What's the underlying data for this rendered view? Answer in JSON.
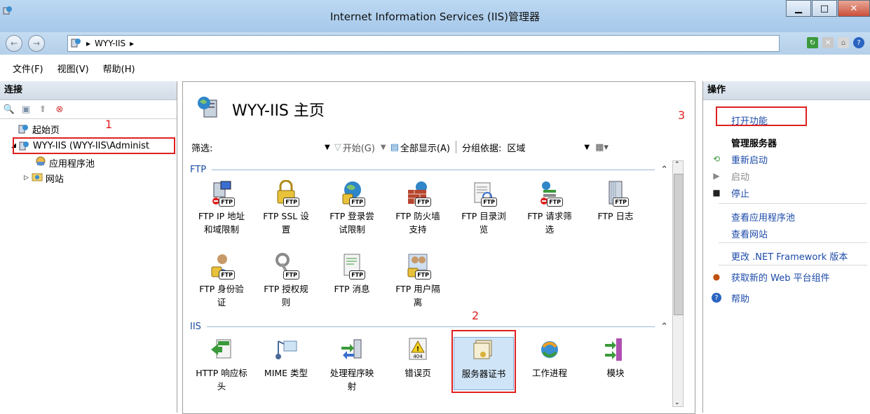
{
  "window": {
    "title": "Internet Information Services (IIS)管理器"
  },
  "address": {
    "path": [
      "WYY-IIS"
    ]
  },
  "menu": [
    "文件(F)",
    "视图(V)",
    "帮助(H)"
  ],
  "left": {
    "header": "连接",
    "tree": [
      {
        "label": "起始页",
        "level": 1
      },
      {
        "label": "WYY-IIS (WYY-IIS\\Administ",
        "level": 1
      },
      {
        "label": "应用程序池",
        "level": 2
      },
      {
        "label": "网站",
        "level": 2
      }
    ],
    "annotation": "1"
  },
  "center": {
    "title": "WYY-IIS 主页",
    "annotation_title": "3",
    "annotation_cert": "2",
    "filter": {
      "label": "筛选:",
      "start": "开始(G)",
      "show_all": "全部显示(A)",
      "group_label": "分组依据:",
      "group_value": "区域"
    },
    "groups": [
      {
        "name": "FTP",
        "features": [
          {
            "l1": "FTP IP 地址",
            "l2": "和域限制"
          },
          {
            "l1": "FTP SSL 设",
            "l2": "置"
          },
          {
            "l1": "FTP 登录尝",
            "l2": "试限制"
          },
          {
            "l1": "FTP 防火墙",
            "l2": "支持"
          },
          {
            "l1": "FTP 目录浏",
            "l2": "览"
          },
          {
            "l1": "FTP 请求筛",
            "l2": "选"
          },
          {
            "l1": "FTP 日志",
            "l2": ""
          },
          {
            "l1": "FTP 身份验",
            "l2": "证"
          },
          {
            "l1": "FTP 授权规",
            "l2": "则"
          },
          {
            "l1": "FTP 消息",
            "l2": ""
          },
          {
            "l1": "FTP 用户隔",
            "l2": "离"
          }
        ]
      },
      {
        "name": "IIS",
        "features": [
          {
            "l1": "HTTP 响应标",
            "l2": "头"
          },
          {
            "l1": "MIME 类型",
            "l2": ""
          },
          {
            "l1": "处理程序映",
            "l2": "射"
          },
          {
            "l1": "错误页",
            "l2": ""
          },
          {
            "l1": "服务器证书",
            "l2": ""
          },
          {
            "l1": "工作进程",
            "l2": ""
          },
          {
            "l1": "模块",
            "l2": ""
          }
        ]
      }
    ]
  },
  "right": {
    "header": "操作",
    "open_feature": "打开功能",
    "manage_server": "管理服务器",
    "restart": "重新启动",
    "start": "启动",
    "stop": "停止",
    "view_app_pools": "查看应用程序池",
    "view_sites": "查看网站",
    "change_net": "更改 .NET Framework 版本",
    "get_components": "获取新的 Web 平台组件",
    "help": "帮助"
  }
}
